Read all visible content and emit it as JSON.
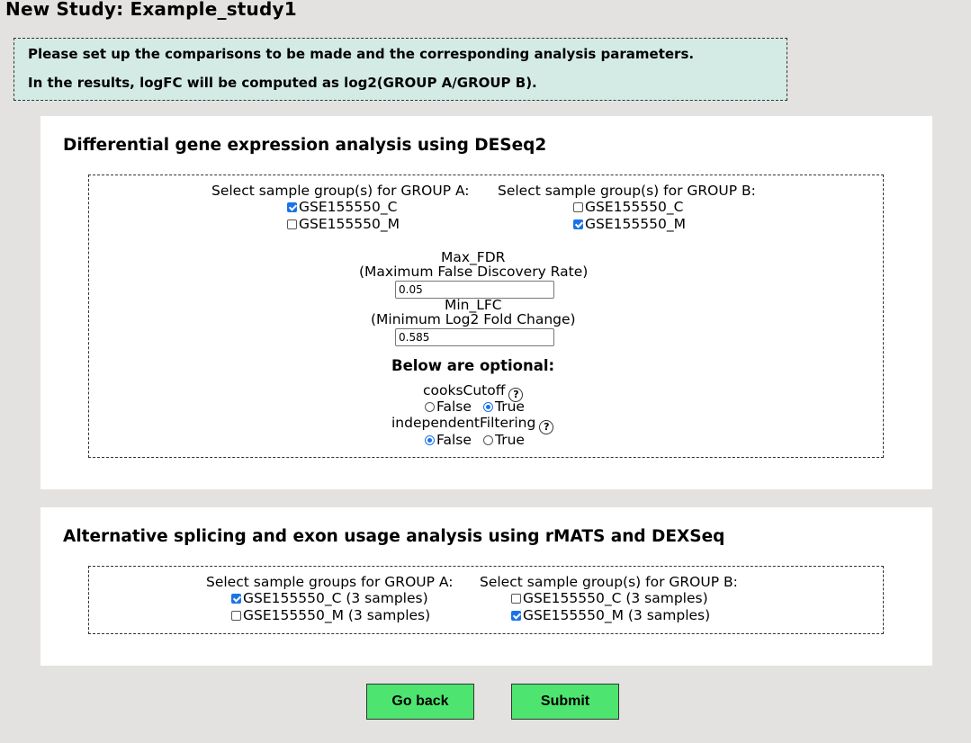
{
  "page_title": "New Study: Example_study1",
  "notice": {
    "line1": "Please set up the comparisons to be made and the corresponding analysis parameters.",
    "line2": "In the results, logFC will be computed as log2(GROUP A/GROUP B)."
  },
  "deseq": {
    "title": "Differential gene expression analysis using DESeq2",
    "group_a_label": "Select sample group(s) for GROUP A:",
    "group_b_label": "Select sample group(s) for GROUP B:",
    "group_a": [
      {
        "label": "GSE155550_C",
        "checked": true
      },
      {
        "label": "GSE155550_M",
        "checked": false
      }
    ],
    "group_b": [
      {
        "label": "GSE155550_C",
        "checked": false
      },
      {
        "label": "GSE155550_M",
        "checked": true
      }
    ],
    "max_fdr_label": "Max_FDR",
    "max_fdr_desc": "(Maximum False Discovery Rate)",
    "max_fdr_value": "0.05",
    "min_lfc_label": "Min_LFC",
    "min_lfc_desc": "(Minimum Log2 Fold Change)",
    "min_lfc_value": "0.585",
    "optional_heading": "Below are optional:",
    "cooks_label": "cooksCutoff",
    "cooks_selected": "True",
    "indep_label": "independentFiltering",
    "indep_selected": "False",
    "false_label": "False",
    "true_label": "True",
    "help_glyph": "?"
  },
  "splicing": {
    "title": "Alternative splicing and exon usage analysis using rMATS and DEXSeq",
    "group_a_label": "Select sample groups for GROUP A:",
    "group_b_label": "Select sample group(s) for GROUP B:",
    "group_a": [
      {
        "label": "GSE155550_C (3 samples)",
        "checked": true
      },
      {
        "label": "GSE155550_M (3 samples)",
        "checked": false
      }
    ],
    "group_b": [
      {
        "label": "GSE155550_C (3 samples)",
        "checked": false
      },
      {
        "label": "GSE155550_M (3 samples)",
        "checked": true
      }
    ]
  },
  "buttons": {
    "back": "Go back",
    "submit": "Submit"
  },
  "colors": {
    "background": "#e3e2e0",
    "notice_bg": "#d4ebe5",
    "button_green": "#4de56f",
    "check_blue": "#1a73e8"
  }
}
